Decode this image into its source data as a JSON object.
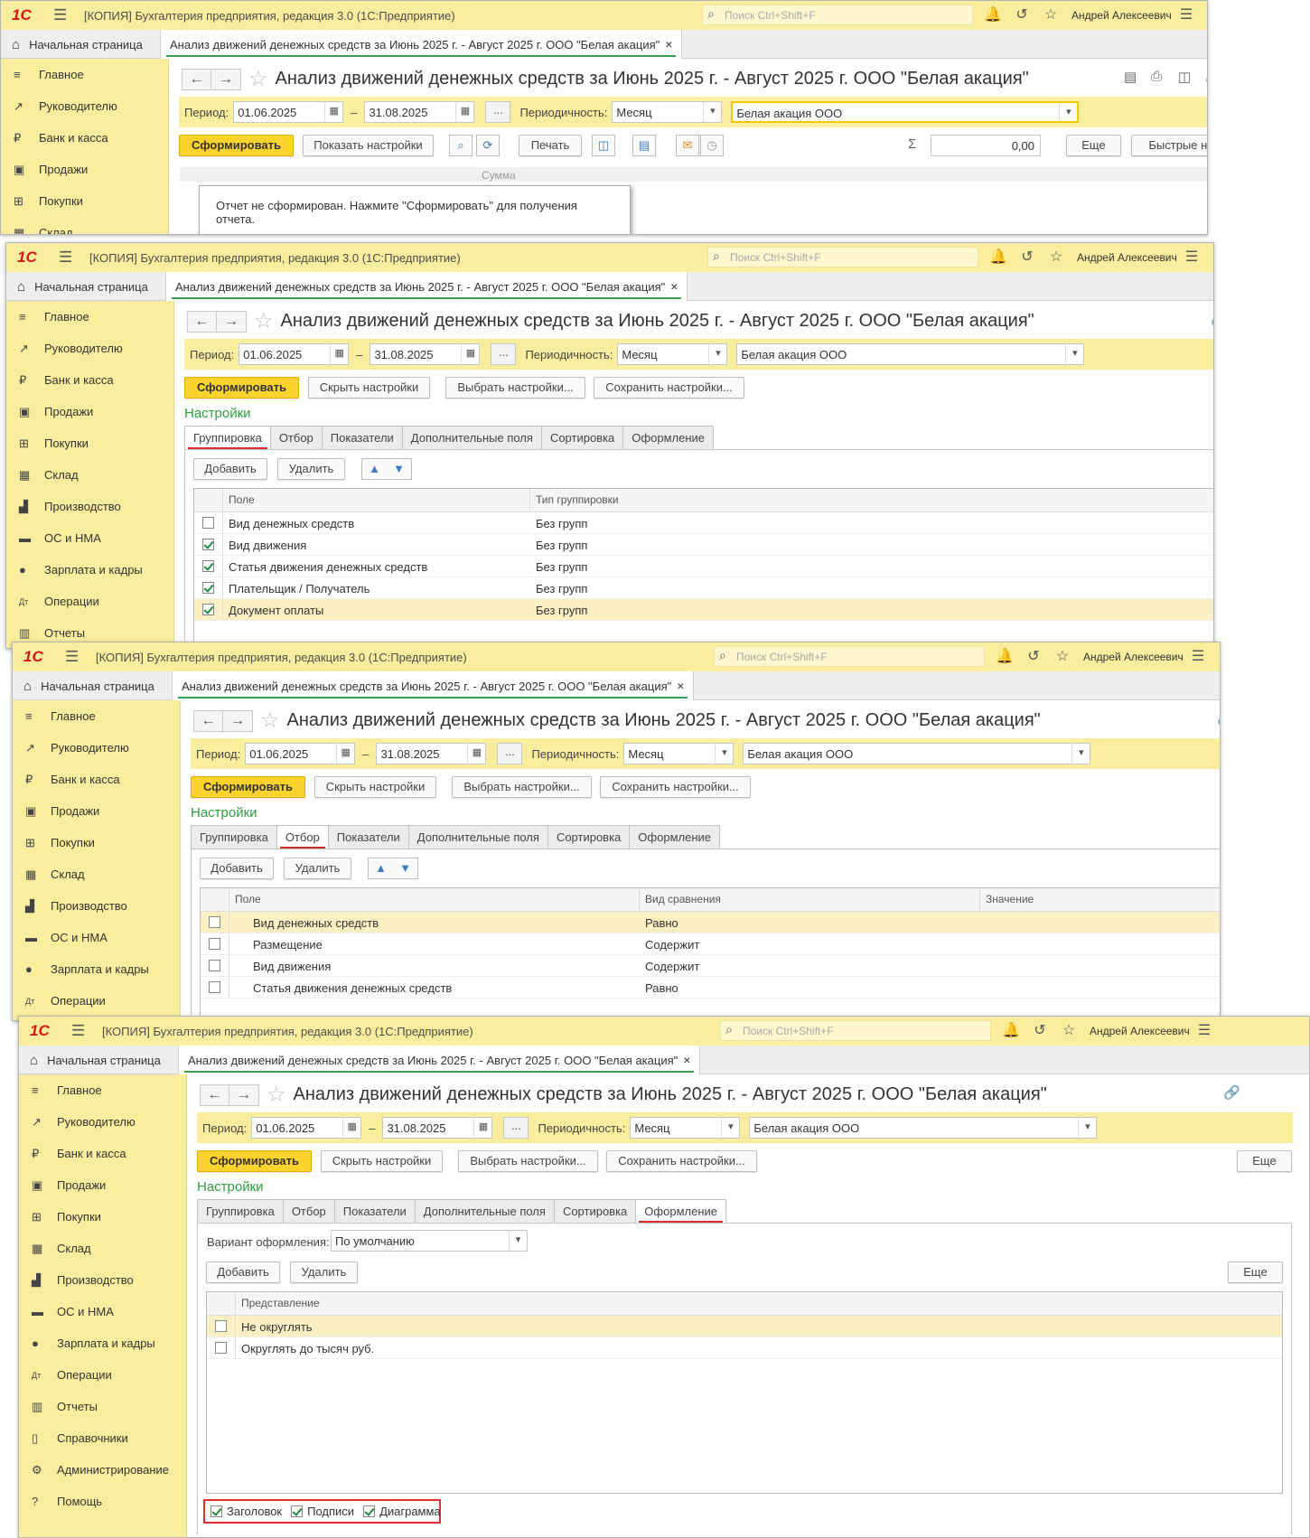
{
  "app": {
    "title": "[КОПИЯ] Бухгалтерия предприятия, редакция 3.0  (1С:Предприятие)",
    "logo": "1С",
    "search_placeholder": "Поиск Ctrl+Shift+F",
    "user": "Андрей Алексеевич",
    "home_tab": "Начальная страница",
    "open_tab": "Анализ движений денежных средств за Июнь 2025 г. - Август 2025 г. ООО \"Белая акация\"",
    "tab_close": "×"
  },
  "sidebar": {
    "items": [
      "Главное",
      "Руководителю",
      "Банк и касса",
      "Продажи",
      "Покупки",
      "Склад",
      "Производство",
      "ОС и НМА",
      "Зарплата и кадры",
      "Операции",
      "Отчеты",
      "Справочники",
      "Администрирование",
      "Помощь"
    ],
    "icons": [
      "≡",
      "↗",
      "₽",
      "🛍",
      "🛒",
      "▦",
      "🏭",
      "🚚",
      "👤",
      "Дт",
      "📊",
      "📖",
      "⚙",
      "?"
    ]
  },
  "form": {
    "title": "Анализ движений денежных средств за Июнь 2025 г. - Август 2025 г. ООО \"Белая акация\"",
    "period_label": "Период:",
    "date_from": "01.06.2025",
    "date_to": "31.08.2025",
    "dots": "...",
    "periodicity_label": "Периодичность:",
    "periodicity": "Месяц",
    "org": "Белая акация ООО",
    "dash": "–"
  },
  "w1": {
    "generate": "Сформировать",
    "show_settings": "Показать настройки",
    "print": "Печать",
    "sum": "0,00",
    "more": "Еще",
    "quick": "Быстрые настройки",
    "col_sum": "Сумма",
    "msg": "Отчет не сформирован. Нажмите \"Сформировать\" для получения отчета."
  },
  "settings": {
    "generate": "Сформировать",
    "hide": "Скрыть настройки",
    "choose": "Выбрать настройки...",
    "save": "Сохранить настройки...",
    "more": "Еще",
    "header": "Настройки",
    "tabs": [
      "Группировка",
      "Отбор",
      "Показатели",
      "Дополнительные поля",
      "Сортировка",
      "Оформление"
    ],
    "add": "Добавить",
    "del": "Удалить"
  },
  "w2": {
    "cols": [
      "Поле",
      "Тип группировки"
    ],
    "rows": [
      {
        "f": "Вид денежных средств",
        "t": "Без групп",
        "c": false
      },
      {
        "f": "Вид движения",
        "t": "Без групп",
        "c": true
      },
      {
        "f": "Статья движения денежных средств",
        "t": "Без групп",
        "c": true
      },
      {
        "f": "Плательщик / Получатель",
        "t": "Без групп",
        "c": true
      },
      {
        "f": "Документ оплаты",
        "t": "Без групп",
        "c": true
      }
    ]
  },
  "w3": {
    "cols": [
      "Поле",
      "Вид сравнения",
      "Значение"
    ],
    "rows": [
      {
        "f": "Вид денежных средств",
        "t": "Равно"
      },
      {
        "f": "Размещение",
        "t": "Содержит"
      },
      {
        "f": "Вид движения",
        "t": "Содержит"
      },
      {
        "f": "Статья движения денежных средств",
        "t": "Равно"
      }
    ]
  },
  "w4": {
    "variant_label": "Вариант оформления:",
    "variant": "По умолчанию",
    "col": "Представление",
    "rows": [
      "Не округлять",
      "Округлять до тысяч руб."
    ],
    "checks": [
      "Заголовок",
      "Подписи",
      "Диаграмма"
    ]
  }
}
